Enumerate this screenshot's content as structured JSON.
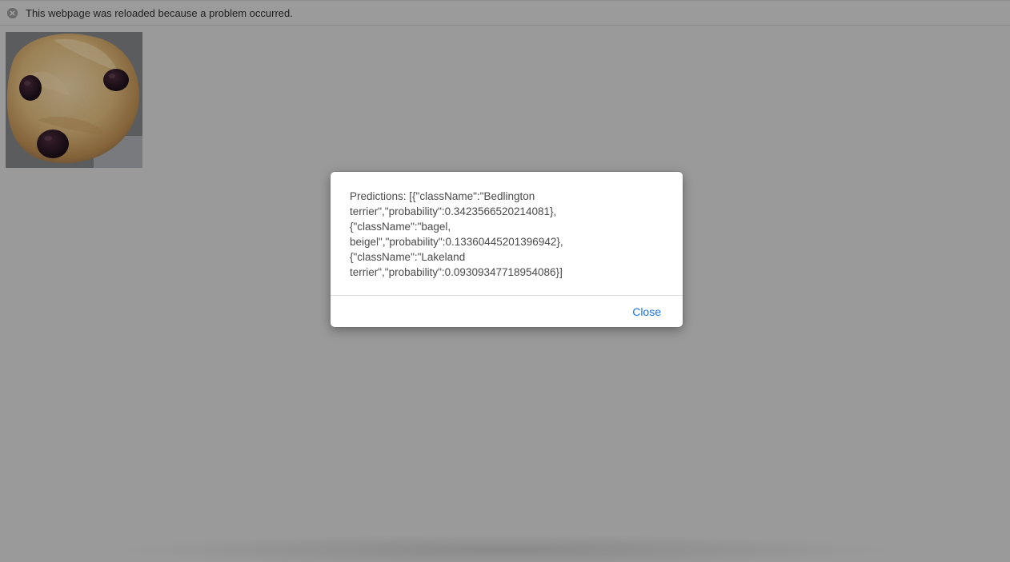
{
  "notice_bar": {
    "icon": "close-circle-icon",
    "text": "This webpage was reloaded because a problem occurred."
  },
  "page_image": {
    "subject": "blueberry muffin photo"
  },
  "dialog": {
    "message": "Predictions: [{\"className\":\"Bedlington\nterrier\",\"probability\":0.3423566520214081},\n{\"className\":\"bagel,\nbeigel\",\"probability\":0.13360445201396942},\n{\"className\":\"Lakeland\nterrier\",\"probability\":0.09309347718954086}]",
    "close_label": "Close"
  },
  "colors": {
    "overlay": "#9a9a9a",
    "link": "#1a73e8",
    "dialog_text": "#4a4a4a"
  }
}
